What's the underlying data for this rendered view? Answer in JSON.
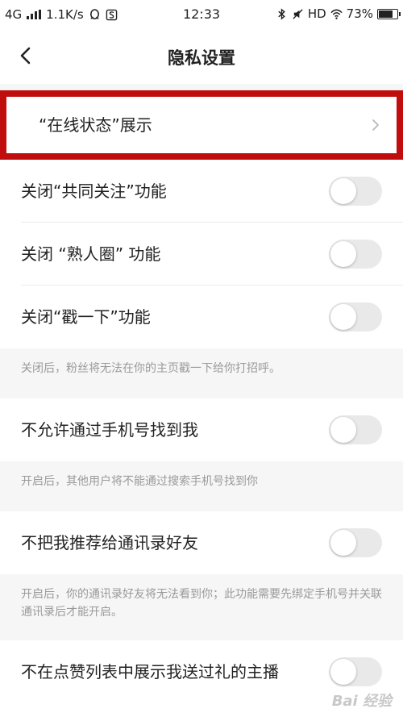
{
  "status_bar": {
    "network": "4G",
    "speed": "1.1K/s",
    "time": "12:33",
    "hd": "HD",
    "battery": "73%"
  },
  "nav": {
    "title": "隐私设置",
    "back_icon": "chevron-left-icon"
  },
  "rows": {
    "online_status": "“在线状态”展示",
    "common_follow": "关闭“共同关注”功能",
    "acquaintance": "关闭 “熟人圈” 功能",
    "poke": "关闭“戳一下”功能",
    "phone_find": "不允许通过手机号找到我",
    "contacts_recommend": "不把我推荐给通讯录好友",
    "gift_list": "不在点赞列表中展示我送过礼的主播"
  },
  "notes": {
    "poke": "关闭后，粉丝将无法在你的主页戳一下给你打招呼。",
    "phone_find": "开启后，其他用户将不能通过搜索手机号找到你",
    "contacts_recommend": "开启后，你的通讯录好友将无法看到你；此功能需要先绑定手机号并关联通讯录后才能开启。"
  },
  "toggles": {
    "common_follow": false,
    "acquaintance": false,
    "poke": false,
    "phone_find": false,
    "contacts_recommend": false,
    "gift_list": false
  },
  "watermark": "Bai 经验",
  "colors": {
    "highlight": "#c00d0d",
    "toggle_off": "#e9e9e9",
    "note_bg": "#f6f6f6"
  }
}
